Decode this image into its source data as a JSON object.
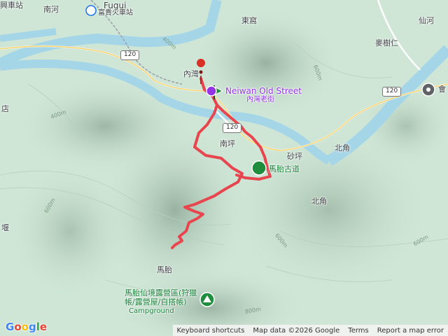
{
  "labels": {
    "nanhe": "南河",
    "fugui_zh": "富貴火車站",
    "fugui_en": "Fugui",
    "dongwo": "東窩",
    "xianhe": "仙河",
    "maishuren": "麥樹仁",
    "neiwan_short": "內灣",
    "neiwan_en": "Neiwan Old Street",
    "neiwan_zh": "內灣老街",
    "nanping": "南坪",
    "shaping": "砂坪",
    "beijiao1": "北角",
    "beijiao2": "北角",
    "magu_trail": "馬胎古道",
    "matai": "馬胎",
    "campground_zh": "馬胎仙境露營區(狩獵帳/露營屋/自搭帳)",
    "campground_en": "Campground",
    "dian": "店",
    "yi": "堰",
    "hui": "會",
    "top_left": "興車站"
  },
  "road_shields": [
    "120",
    "120",
    "120"
  ],
  "contours": [
    "400m",
    "400m",
    "600m",
    "600m",
    "600m",
    "800m",
    "600m"
  ],
  "footer": {
    "shortcuts": "Keyboard shortcuts",
    "data": "Map data ©2026 Google",
    "terms": "Terms",
    "report": "Report a map error"
  },
  "logo": "Google",
  "colors": {
    "river": "#a5d6e8",
    "terrain": "#cfe6d6",
    "track": "#e8464f",
    "poi": "#9334e6",
    "park": "#1e8e3e"
  }
}
